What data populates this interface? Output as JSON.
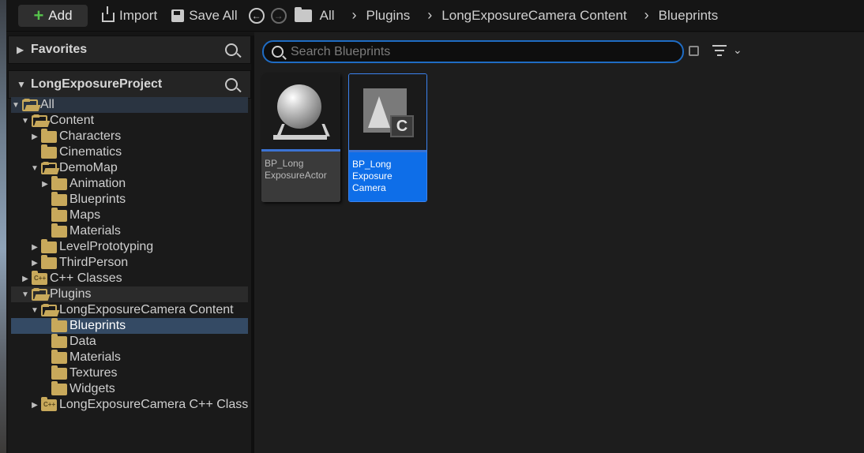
{
  "toolbar": {
    "add_label": "Add",
    "import_label": "Import",
    "save_all_label": "Save All"
  },
  "breadcrumb": [
    "All",
    "Plugins",
    "LongExposureCamera Content",
    "Blueprints"
  ],
  "sections": {
    "favorites": "Favorites",
    "project": "LongExposureProject"
  },
  "tree": [
    {
      "label": "All"
    },
    {
      "label": "Content"
    },
    {
      "label": "Characters"
    },
    {
      "label": "Cinematics"
    },
    {
      "label": "DemoMap"
    },
    {
      "label": "Animation"
    },
    {
      "label": "Blueprints"
    },
    {
      "label": "Maps"
    },
    {
      "label": "Materials"
    },
    {
      "label": "LevelPrototyping"
    },
    {
      "label": "ThirdPerson"
    },
    {
      "label": "C++ Classes"
    },
    {
      "label": "Plugins"
    },
    {
      "label": "LongExposureCamera Content"
    },
    {
      "label": "Blueprints"
    },
    {
      "label": "Data"
    },
    {
      "label": "Materials"
    },
    {
      "label": "Textures"
    },
    {
      "label": "Widgets"
    },
    {
      "label": "LongExposureCamera C++ Classes"
    }
  ],
  "search": {
    "placeholder": "Search Blueprints",
    "value": ""
  },
  "assets": [
    {
      "line1": "BP_Long",
      "line2": "ExposureActor",
      "line3": ""
    },
    {
      "line1": "BP_Long",
      "line2": "Exposure",
      "line3": "Camera"
    }
  ],
  "colors": {
    "accent": "#0e6ee8",
    "folder": "#c8a95b",
    "selection": "#344a64"
  }
}
